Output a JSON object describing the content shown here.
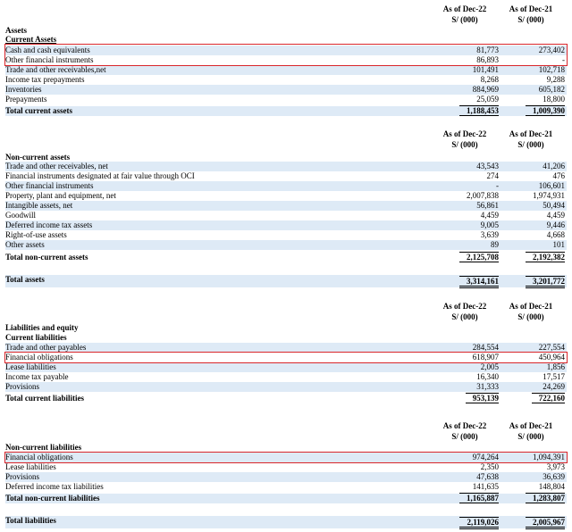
{
  "headers": {
    "col1_l1": "As of Dec-22",
    "col1_l2": "S/ (000)",
    "col2_l1": "As of Dec-21",
    "col2_l2": "S/ (000)"
  },
  "assets_title": "Assets",
  "current_assets_title": "Current Assets",
  "current_assets": [
    {
      "label": "Cash and cash equivalents",
      "v1": "81,773",
      "v2": "273,402"
    },
    {
      "label": "Other financial instruments",
      "v1": "86,893",
      "v2": "-"
    },
    {
      "label": "Trade and other receivables,net",
      "v1": "101,491",
      "v2": "102,718"
    },
    {
      "label": "Income tax prepayments",
      "v1": "8,268",
      "v2": "9,288"
    },
    {
      "label": "Inventories",
      "v1": "884,969",
      "v2": "605,182"
    },
    {
      "label": "Prepayments",
      "v1": "25,059",
      "v2": "18,800"
    },
    {
      "label": "Total current assets",
      "v1": "1,188,453",
      "v2": "1,009,390"
    }
  ],
  "noncurrent_assets_title": "Non-current assets",
  "noncurrent_assets": [
    {
      "label": "Trade and other receivables, net",
      "v1": "43,543",
      "v2": "41,206"
    },
    {
      "label": "Financial instruments designated at fair value through OCI",
      "v1": "274",
      "v2": "476"
    },
    {
      "label": "Other financial instruments",
      "v1": "-",
      "v2": "106,601"
    },
    {
      "label": "Property, plant and equipment, net",
      "v1": "2,007,838",
      "v2": "1,974,931"
    },
    {
      "label": "Intangible assets, net",
      "v1": "56,861",
      "v2": "50,494"
    },
    {
      "label": "Goodwill",
      "v1": "4,459",
      "v2": "4,459"
    },
    {
      "label": "Deferred income tax assets",
      "v1": "9,005",
      "v2": "9,446"
    },
    {
      "label": "Right-of-use assets",
      "v1": "3,639",
      "v2": "4,668"
    },
    {
      "label": "Other assets",
      "v1": "89",
      "v2": "101"
    },
    {
      "label": "Total non-current assets",
      "v1": "2,125,708",
      "v2": "2,192,382"
    }
  ],
  "total_assets": {
    "label": "Total assets",
    "v1": "3,314,161",
    "v2": "3,201,772"
  },
  "liab_equity_title": "Liabilities and equity",
  "current_liab_title": "Current liabilities",
  "current_liab": [
    {
      "label": "Trade and other payables",
      "v1": "284,554",
      "v2": "227,554"
    },
    {
      "label": "Financial obligations",
      "v1": "618,907",
      "v2": "450,964"
    },
    {
      "label": "Lease liabilities",
      "v1": "2,005",
      "v2": "1,856"
    },
    {
      "label": "Income tax payable",
      "v1": "16,340",
      "v2": "17,517"
    },
    {
      "label": "Provisions",
      "v1": "31,333",
      "v2": "24,269"
    },
    {
      "label": "Total current liabilities",
      "v1": "953,139",
      "v2": "722,160"
    }
  ],
  "noncurrent_liab_title": "Non-current liabilities",
  "noncurrent_liab": [
    {
      "label": "Financial obligations",
      "v1": "974,264",
      "v2": "1,094,391"
    },
    {
      "label": "Lease liabilities",
      "v1": "2,350",
      "v2": "3,973"
    },
    {
      "label": "Provisions",
      "v1": "47,638",
      "v2": "36,639"
    },
    {
      "label": "Deferred income tax liabilities",
      "v1": "141,635",
      "v2": "148,804"
    },
    {
      "label": "Total non-current liabilities",
      "v1": "1,165,887",
      "v2": "1,283,807"
    }
  ],
  "total_liabilities": {
    "label": "Total liabilities",
    "v1": "2,119,026",
    "v2": "2,005,967"
  },
  "colors": {
    "row_blue": "#deeaf6",
    "highlight_red": "#d9262b"
  }
}
